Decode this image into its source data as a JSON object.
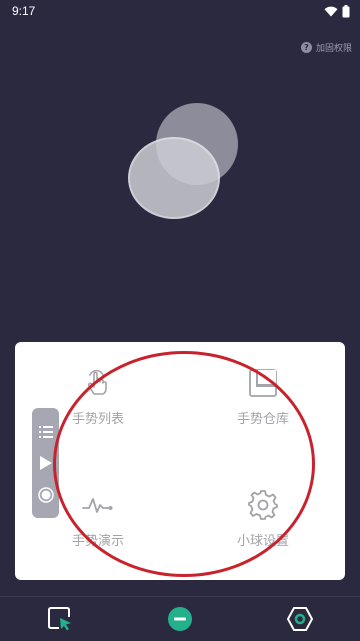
{
  "status_bar": {
    "time": "9:17"
  },
  "permission_link": {
    "icon": "question-icon",
    "label": "加固权限"
  },
  "panel": {
    "items": [
      {
        "label": "手势列表",
        "icon": "tap-gesture-icon"
      },
      {
        "label": "手势仓库",
        "icon": "gesture-store-icon"
      },
      {
        "label": "手势演示",
        "icon": "waveform-icon"
      },
      {
        "label": "小球设置",
        "icon": "gear-icon"
      }
    ]
  },
  "side_toolbar": {
    "icons": [
      "list-icon",
      "play-icon",
      "record-icon"
    ]
  },
  "bottom_nav": {
    "icons": [
      "cursor-select-icon",
      "ball-toggle-icon",
      "hexagon-settings-icon"
    ]
  },
  "colors": {
    "background": "#2a2940",
    "panel": "#ffffff",
    "accent_green": "#23b08a",
    "annotation_red": "#c8232c"
  }
}
